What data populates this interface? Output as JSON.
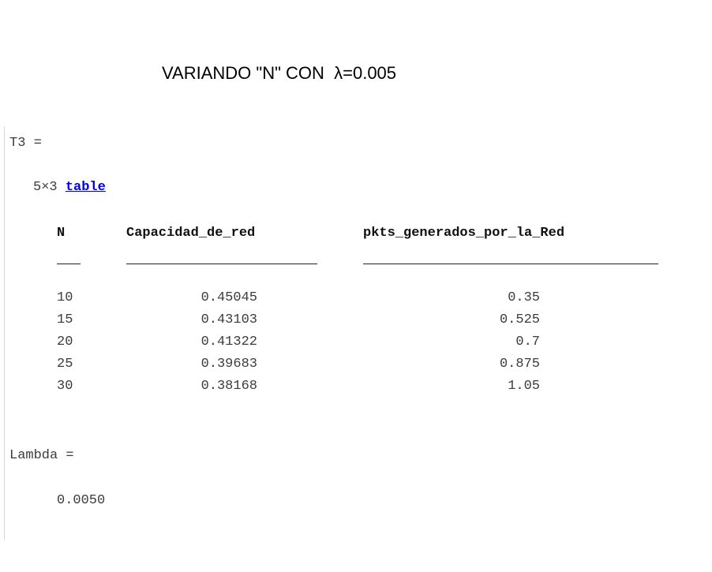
{
  "title": "VARIANDO \"N\" CON  λ=0.005",
  "console": {
    "table_var": {
      "assignment": "T3 =",
      "size": "5×3",
      "type_link": "table"
    },
    "table": {
      "columns": [
        "N",
        "Capacidad_de_red",
        "pkts_generados_por_la_Red"
      ],
      "rows": [
        {
          "n": "10",
          "capacidad": "0.45045",
          "pkts": "0.35"
        },
        {
          "n": "15",
          "capacidad": "0.43103",
          "pkts": "0.525"
        },
        {
          "n": "20",
          "capacidad": "0.41322",
          "pkts": "0.7"
        },
        {
          "n": "25",
          "capacidad": "0.39683",
          "pkts": "0.875"
        },
        {
          "n": "30",
          "capacidad": "0.38168",
          "pkts": "1.05"
        }
      ]
    },
    "lambda_var": {
      "assignment": "Lambda =",
      "value": "0.0050"
    }
  },
  "colors": {
    "text": "#3c3c3c",
    "link": "#0000ee",
    "header": "#111111"
  }
}
